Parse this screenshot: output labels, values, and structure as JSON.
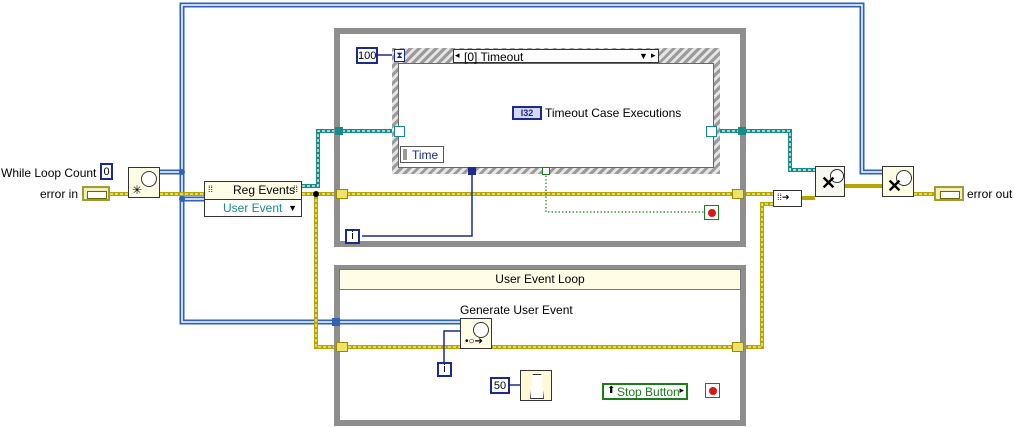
{
  "labels": {
    "while_loop_count": "While Loop Count",
    "error_in": "error in",
    "error_out": "error out",
    "reg_events": "Reg Events",
    "user_event": "User Event",
    "event_case": "[0] Timeout",
    "timeout_case_executions": "Timeout Case Executions",
    "i32": "I32",
    "time": "Time",
    "user_event_loop": "User Event Loop",
    "generate_user_event": "Generate User Event",
    "stop_button": "Stop Button",
    "iteration": "i"
  },
  "constants": {
    "loop_count": "0",
    "timeout_ms": "100",
    "wait_ms": "50"
  },
  "colors": {
    "refnum_wire": "#2e62b8",
    "error_wire": "#b5a500",
    "event_wire": "#178a8a",
    "numeric_blue": "#1b2a8c",
    "boolean_green": "#1a7d1a",
    "loop_gray": "#8e8e8e"
  }
}
